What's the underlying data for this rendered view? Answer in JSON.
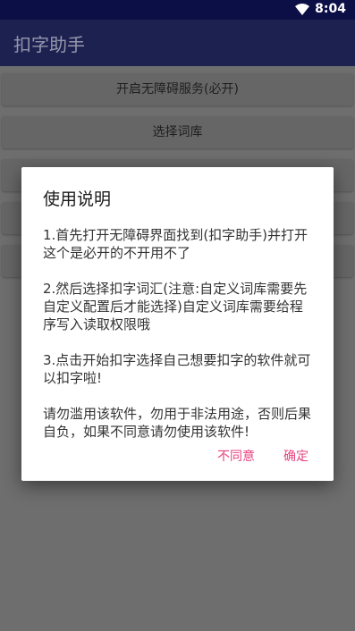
{
  "status_bar": {
    "time": "8:04",
    "wifi_icon": "wifi-icon"
  },
  "app_bar": {
    "title": "扣字助手"
  },
  "main": {
    "buttons": [
      {
        "label": "开启无障碍服务(必开)"
      },
      {
        "label": "选择词库"
      },
      {
        "label": ""
      },
      {
        "label": ""
      },
      {
        "label": ""
      }
    ]
  },
  "dialog": {
    "title": "使用说明",
    "paragraphs": [
      "1.首先打开无障碍界面找到(扣字助手)并打开这个是必开的不开用不了",
      "2.然后选择扣字词汇(注意:自定义词库需要先自定义配置后才能选择)自定义词库需要给程序写入读取权限哦",
      "3.点击开始扣字选择自己想要扣字的软件就可以扣字啦!",
      "请勿滥用该软件，勿用于非法用途，否则后果自负，如果不同意请勿使用该软件!"
    ],
    "disagree_label": "不同意",
    "confirm_label": "确定"
  },
  "colors": {
    "status_bar": "#0c0f45",
    "app_bar": "#1d214f",
    "scrim": "#6e6e6e",
    "accent": "#e8437e"
  }
}
